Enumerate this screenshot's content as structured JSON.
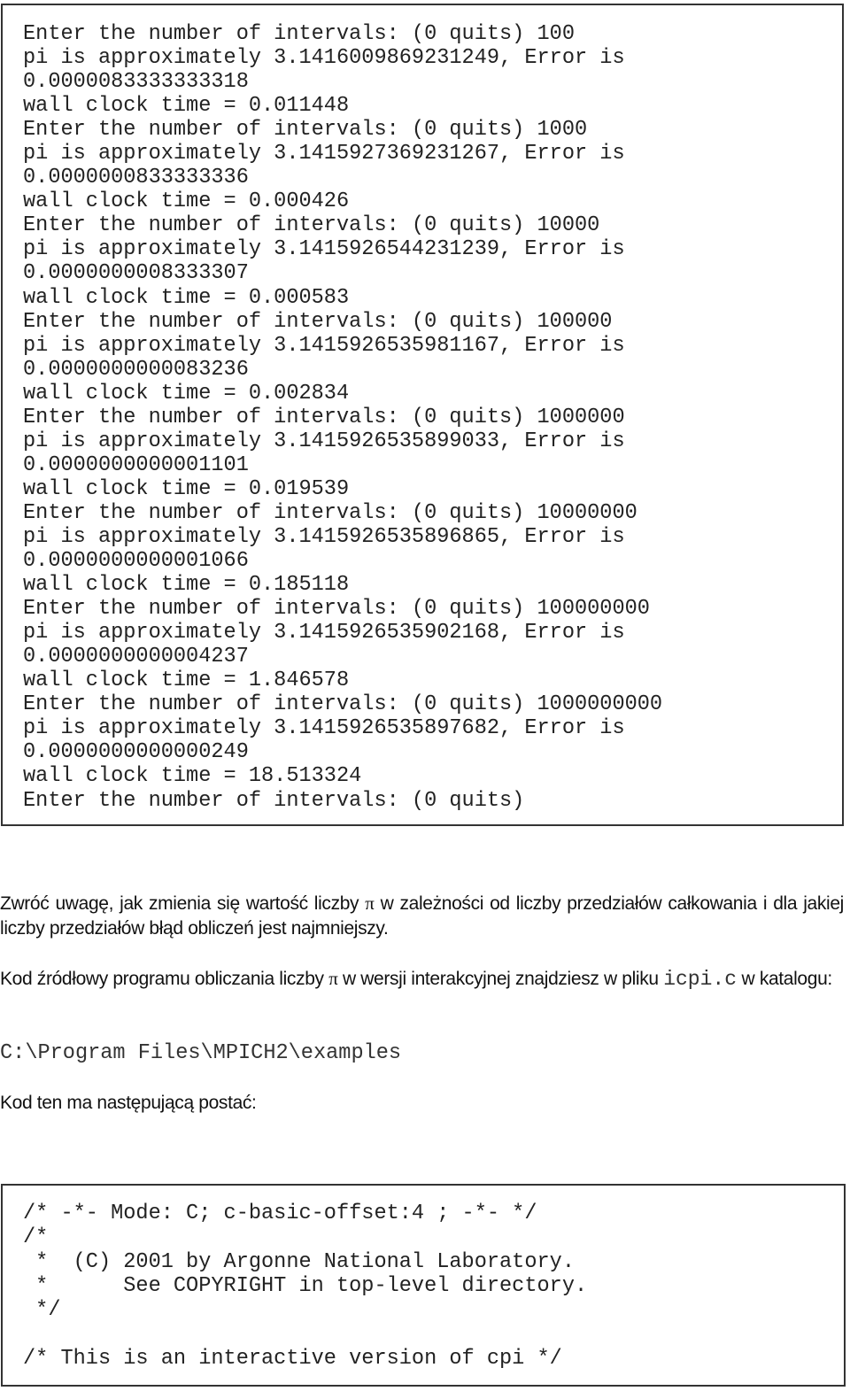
{
  "console_output": [
    "Enter the number of intervals: (0 quits) 100",
    "pi is approximately 3.1416009869231249, Error is",
    "0.0000083333333318",
    "wall clock time = 0.011448",
    "Enter the number of intervals: (0 quits) 1000",
    "pi is approximately 3.1415927369231267, Error is",
    "0.0000000833333336",
    "wall clock time = 0.000426",
    "Enter the number of intervals: (0 quits) 10000",
    "pi is approximately 3.1415926544231239, Error is",
    "0.0000000008333307",
    "wall clock time = 0.000583",
    "Enter the number of intervals: (0 quits) 100000",
    "pi is approximately 3.1415926535981167, Error is",
    "0.0000000000083236",
    "wall clock time = 0.002834",
    "Enter the number of intervals: (0 quits) 1000000",
    "pi is approximately 3.1415926535899033, Error is",
    "0.0000000000001101",
    "wall clock time = 0.019539",
    "Enter the number of intervals: (0 quits) 10000000",
    "pi is approximately 3.1415926535896865, Error is",
    "0.0000000000001066",
    "wall clock time = 0.185118",
    "Enter the number of intervals: (0 quits) 100000000",
    "pi is approximately 3.1415926535902168, Error is",
    "0.0000000000004237",
    "wall clock time = 1.846578",
    "Enter the number of intervals: (0 quits) 1000000000",
    "pi is approximately 3.1415926535897682, Error is",
    "0.0000000000000249",
    "wall clock time = 18.513324",
    "Enter the number of intervals: (0 quits)"
  ],
  "paragraph1": {
    "before_pi": "Zwróć uwagę, jak zmienia się wartość liczby ",
    "pi": "π",
    "after_pi": " w zależności od liczby przedziałów całkowania i dla jakiej liczby przedziałów błąd obliczeń jest najmniejszy."
  },
  "paragraph2": {
    "before_pi": "Kod źródłowy programu obliczania liczby ",
    "pi": "π",
    "after_pi": " w wersji interakcyjnej znajdziesz w pliku ",
    "filename": "icpi.c",
    "after_filename": " w katalogu:"
  },
  "path": "C:\\Program Files\\MPICH2\\examples",
  "paragraph3": "Kod ten ma następującą postać:",
  "source_code": [
    "/* -*- Mode: C; c-basic-offset:4 ; -*- */",
    "/*",
    " *  (C) 2001 by Argonne National Laboratory.",
    " *      See COPYRIGHT in top-level directory.",
    " */",
    "",
    "/* This is an interactive version of cpi */"
  ]
}
